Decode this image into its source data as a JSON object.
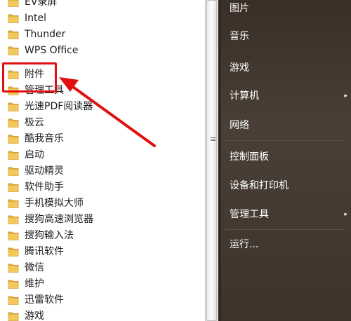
{
  "programs": [
    {
      "label": "EV录屏"
    },
    {
      "label": "Intel"
    },
    {
      "label": "Thunder"
    },
    {
      "label": "WPS Office"
    },
    {
      "label": "附件"
    },
    {
      "label": "管理工具"
    },
    {
      "label": "光速PDF阅读器"
    },
    {
      "label": "极云"
    },
    {
      "label": "酷我音乐"
    },
    {
      "label": "启动"
    },
    {
      "label": "驱动精灵"
    },
    {
      "label": "软件助手"
    },
    {
      "label": "手机模拟大师"
    },
    {
      "label": "搜狗高速浏览器"
    },
    {
      "label": "搜狗输入法"
    },
    {
      "label": "腾讯软件"
    },
    {
      "label": "微信"
    },
    {
      "label": "维护"
    },
    {
      "label": "迅雷软件"
    },
    {
      "label": "游戏"
    }
  ],
  "right_menu": {
    "pictures": "图片",
    "music": "音乐",
    "games": "游戏",
    "computer": "计算机",
    "network": "网络",
    "control_panel": "控制面板",
    "devices_printers": "设备和打印机",
    "admin_tools": "管理工具",
    "run": "运行...",
    "submenu_arrow": "▸"
  },
  "scrollbar": {
    "grip": "≡"
  },
  "colors": {
    "highlight": "#e01010",
    "menu_bg": "#3a2f26",
    "menu_text": "#ffffff",
    "folder": "#e6b33e"
  }
}
